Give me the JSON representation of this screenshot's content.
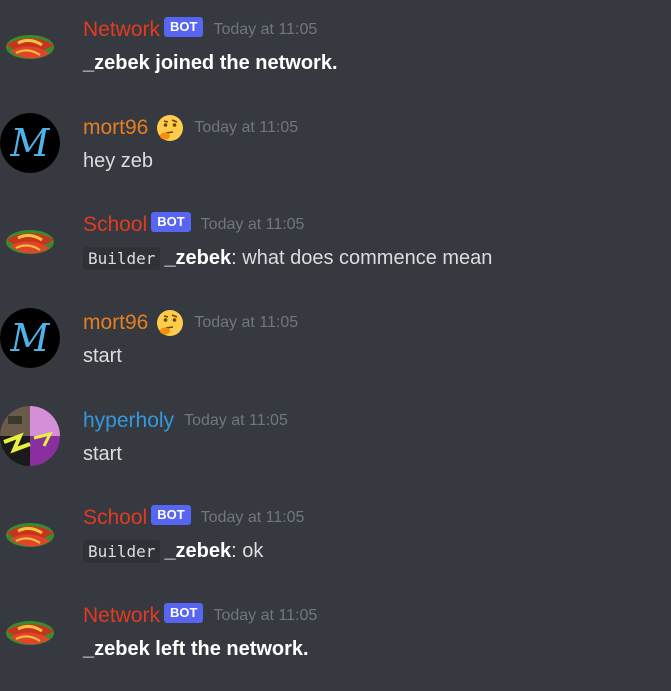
{
  "colors": {
    "background": "#36393f",
    "bot_tag": "#5865f2",
    "timestamp": "#72767d",
    "network_name": "#e23b22",
    "school_name": "#e23b22",
    "mort_name": "#e67e22",
    "hyper_name": "#3498db"
  },
  "messages": [
    {
      "author": "Network",
      "bot_tag": "BOT",
      "timestamp": "Today at 11:05",
      "text": "_zebek joined the network.",
      "avatar_icon": "red-serpent-avatar"
    },
    {
      "author": "mort96",
      "emoji": "thinking-face-emoji",
      "timestamp": "Today at 11:05",
      "text": "hey zeb",
      "avatar_icon": "letter-m-avatar"
    },
    {
      "author": "School",
      "bot_tag": "BOT",
      "timestamp": "Today at 11:05",
      "code": "Builder",
      "mention": "_zebek",
      "separator": ":",
      "text": "what does commence mean",
      "avatar_icon": "red-serpent-avatar"
    },
    {
      "author": "mort96",
      "emoji": "thinking-face-emoji",
      "timestamp": "Today at 11:05",
      "text": "start",
      "avatar_icon": "letter-m-avatar"
    },
    {
      "author": "hyperholy",
      "timestamp": "Today at 11:05",
      "text": "start",
      "avatar_icon": "glitch-art-avatar"
    },
    {
      "author": "School",
      "bot_tag": "BOT",
      "timestamp": "Today at 11:05",
      "code": "Builder",
      "mention": "_zebek",
      "separator": ":",
      "text": "ok",
      "avatar_icon": "red-serpent-avatar"
    },
    {
      "author": "Network",
      "bot_tag": "BOT",
      "timestamp": "Today at 11:05",
      "text": "_zebek left the network.",
      "avatar_icon": "red-serpent-avatar"
    }
  ]
}
